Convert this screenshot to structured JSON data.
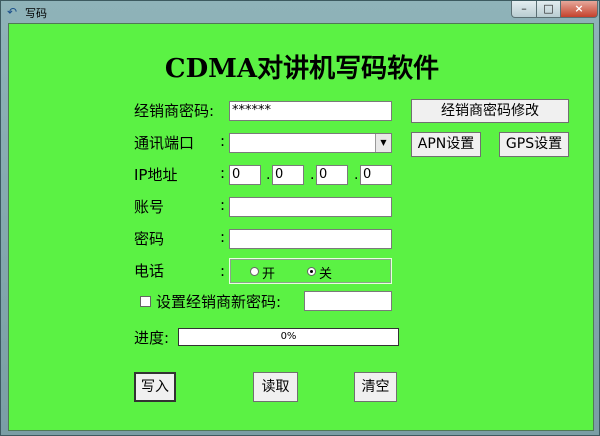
{
  "window": {
    "title": "写码"
  },
  "app_title": "CDMA对讲机写码软件",
  "dealer_password": {
    "label": "经销商密码:",
    "value": "******"
  },
  "port": {
    "label": "通讯端口",
    "colon": ":",
    "value": ""
  },
  "ip": {
    "label": "IP地址",
    "colon": ":",
    "octets": [
      "0",
      "0",
      "0",
      "0"
    ],
    "dot": "."
  },
  "account": {
    "label": "账号",
    "colon": ":",
    "value": ""
  },
  "password": {
    "label": "密码",
    "colon": ":",
    "value": ""
  },
  "phone": {
    "label": "电话",
    "colon": ":",
    "on_label": "开",
    "off_label": "关",
    "selected": "关"
  },
  "new_dealer_password": {
    "label": "设置经销商新密码:",
    "checked": false,
    "value": ""
  },
  "progress": {
    "label": "进度:",
    "text": "0%",
    "value": 0
  },
  "buttons": {
    "modify_dealer_password": "经销商密码修改",
    "apn_settings": "APN设置",
    "gps_settings": "GPS设置",
    "write": "写入",
    "read": "读取",
    "clear": "清空"
  }
}
